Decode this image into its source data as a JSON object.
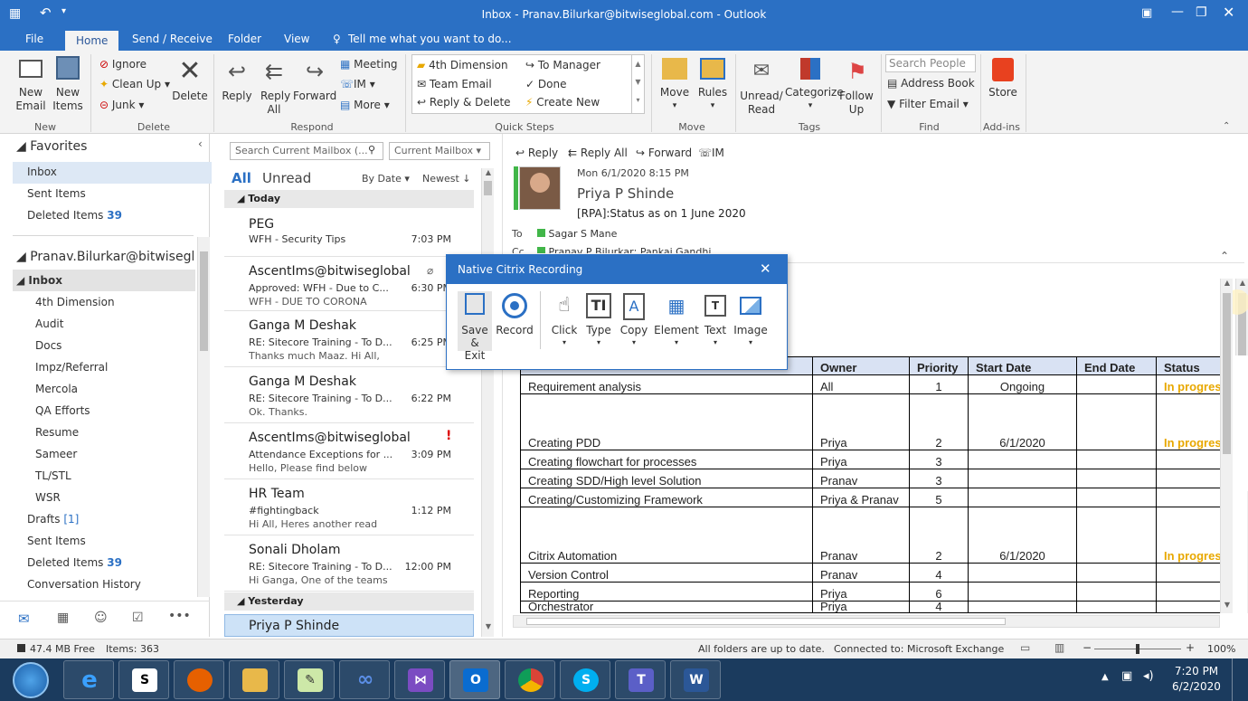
{
  "window": {
    "title": "Inbox - Pranav.Bilurkar@bitwiseglobal.com  -  Outlook"
  },
  "tabs": [
    "File",
    "Home",
    "Send / Receive",
    "Folder",
    "View"
  ],
  "tell_me": "Tell me what you want to do...",
  "ribbon": {
    "new_email": "New Email",
    "new_items": "New Items",
    "ignore": "Ignore",
    "clean_up": "Clean Up",
    "junk": "Junk",
    "delete": "Delete",
    "reply": "Reply",
    "reply_all": "Reply All",
    "forward": "Forward",
    "meeting": "Meeting",
    "im": "IM",
    "more": "More",
    "quick_steps": [
      "4th Dimension",
      "Team Email",
      "Reply & Delete",
      "To Manager",
      "Done",
      "Create New"
    ],
    "move": "Move",
    "rules": "Rules",
    "unread_read": "Unread/ Read",
    "categorize": "Categorize",
    "follow_up": "Follow Up",
    "search_people_placeholder": "Search People",
    "address_book": "Address Book",
    "filter_email": "Filter Email",
    "store": "Store",
    "groups": [
      "New",
      "Delete",
      "Respond",
      "Quick Steps",
      "Move",
      "Tags",
      "Find",
      "Add-ins"
    ]
  },
  "folders": {
    "favorites_label": "Favorites",
    "favorites": [
      {
        "label": "Inbox",
        "count": ""
      },
      {
        "label": "Sent Items",
        "count": ""
      },
      {
        "label": "Deleted Items",
        "count": "39"
      }
    ],
    "account": "Pranav.Bilurkar@bitwiseglobal.com",
    "inbox_label": "Inbox",
    "subfolders": [
      "4th Dimension",
      "Audit",
      "Docs",
      "Impz/Referral",
      "Mercola",
      "QA Efforts",
      "Resume",
      "Sameer",
      "TL/STL",
      "WSR"
    ],
    "others": [
      {
        "label": "Drafts",
        "count": "[1]"
      },
      {
        "label": "Sent Items",
        "count": ""
      },
      {
        "label": "Deleted Items",
        "count": "39"
      },
      {
        "label": "Conversation History",
        "count": ""
      }
    ]
  },
  "search": {
    "placeholder": "Search Current Mailbox (...",
    "scope": "Current Mailbox"
  },
  "list": {
    "filter_all": "All",
    "filter_unread": "Unread",
    "sort_by": "By Date",
    "order": "Newest",
    "today_label": "Today",
    "yesterday_label": "Yesterday",
    "messages": [
      {
        "sender": "PEG",
        "subject": "WFH - Security Tips",
        "time": "7:03 PM",
        "preview": ""
      },
      {
        "sender": "AscentIms@bitwiseglobal.com",
        "subject": "Approved: WFH - Due to C...",
        "time": "6:30 PM",
        "preview": "WFH - DUE TO CORONA"
      },
      {
        "sender": "Ganga M Deshak",
        "subject": "RE: Sitecore Training - To D...",
        "time": "6:25 PM",
        "preview": "Thanks much Maaz.  Hi All,"
      },
      {
        "sender": "Ganga M Deshak",
        "subject": "RE: Sitecore Training - To D...",
        "time": "6:22 PM",
        "preview": "Ok. Thanks."
      },
      {
        "sender": "AscentIms@bitwiseglobal.com",
        "subject": "Attendance Exceptions for ...",
        "time": "3:09 PM",
        "preview": "Hello,      Please find below"
      },
      {
        "sender": "HR Team",
        "subject": "#fightingback",
        "time": "1:12 PM",
        "preview": "Hi All,   Heres another read"
      },
      {
        "sender": "Sonali Dholam",
        "subject": "RE: Sitecore Training - To D...",
        "time": "12:00 PM",
        "preview": "Hi Ganga,  One of the teams"
      }
    ],
    "yesterday_sender": "Priya P Shinde"
  },
  "reading": {
    "reply": "Reply",
    "reply_all": "Reply All",
    "forward": "Forward",
    "im": "IM",
    "date": "Mon 6/1/2020 8:15 PM",
    "sender": "Priya P Shinde",
    "subject": "[RPA]:Status as on 1 June 2020",
    "to_label": "To",
    "to": "Sagar S Mane",
    "cc_label": "Cc",
    "cc": "Pranav P Bilurkar;   Pankaj Gandhi",
    "table": {
      "headers": [
        "",
        "Owner",
        "Priority",
        "Start Date",
        "End Date",
        "Status"
      ],
      "rows": [
        [
          "Requirement analysis",
          "All",
          "1",
          "Ongoing",
          "",
          "In progress"
        ],
        [
          "Creating PDD",
          "Priya",
          "2",
          "6/1/2020",
          "",
          "In progress"
        ],
        [
          "Creating flowchart for processes",
          "Priya",
          "3",
          "",
          "",
          ""
        ],
        [
          "Creating SDD/High level Solution",
          "Pranav",
          "3",
          "",
          "",
          ""
        ],
        [
          "Creating/Customizing Framework",
          "Priya & Pranav",
          "5",
          "",
          "",
          ""
        ],
        [
          "Citrix Automation",
          "Pranav",
          "2",
          "6/1/2020",
          "",
          "In progress"
        ],
        [
          "Version Control",
          "Pranav",
          "4",
          "",
          "",
          ""
        ],
        [
          "Reporting",
          "Priya",
          "6",
          "",
          "",
          ""
        ],
        [
          "Orchestrator",
          "Priya",
          "4",
          "",
          "",
          ""
        ]
      ]
    }
  },
  "dialog": {
    "title": "Native Citrix Recording",
    "buttons": [
      "Save & Exit",
      "Record",
      "Click",
      "Type",
      "Copy",
      "Element",
      "Text",
      "Image"
    ]
  },
  "status": {
    "free": "47.4 MB Free",
    "items": "Items: 363",
    "sync": "All folders are up to date.",
    "connection": "Connected to: Microsoft Exchange",
    "zoom": "100%"
  },
  "taskbar": {
    "time": "7:20 PM",
    "date": "6/2/2020"
  },
  "colors": {
    "accent": "#2b70c4",
    "status_progress": "#e8a800",
    "table_header": "#d9e2f3"
  }
}
